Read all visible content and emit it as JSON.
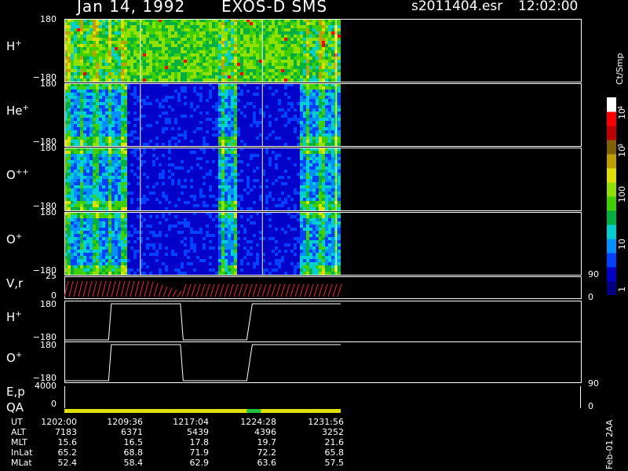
{
  "header": {
    "date": "Jan 14, 1992",
    "instrument": "EXOS-D SMS",
    "file": "s2011404.esr",
    "start_time": "12:02:00"
  },
  "panels": [
    {
      "label_base": "H",
      "label_sup": "+",
      "top_tick": "180",
      "bottom_tick": "−180"
    },
    {
      "label_base": "He",
      "label_sup": "+",
      "top_tick": "180",
      "bottom_tick": "−180"
    },
    {
      "label_base": "O",
      "label_sup": "++",
      "top_tick": "180",
      "bottom_tick": "−180"
    },
    {
      "label_base": "O",
      "label_sup": "+",
      "top_tick": "180",
      "bottom_tick": "−180"
    }
  ],
  "vr_panel": {
    "label": "V,r",
    "top_tick": "25",
    "bottom_tick": "0",
    "right_top": "90",
    "right_bottom": "0"
  },
  "angle_panels": [
    {
      "label_base": "H",
      "label_sup": "+",
      "top_tick": "180",
      "bottom_tick": "−180"
    },
    {
      "label_base": "O",
      "label_sup": "+",
      "top_tick": "180",
      "bottom_tick": "−180"
    }
  ],
  "ep_panel": {
    "label": "E,p",
    "top_tick": "4000",
    "bottom_tick": "0",
    "right_top": "90",
    "right_bottom": "0"
  },
  "qa_panel": {
    "label": "QA"
  },
  "colorbar": {
    "unit": "Ct/Smp",
    "labels": [
      "1",
      "10",
      "100",
      "10",
      "10",
      "3",
      "4"
    ],
    "colors": [
      "#000080",
      "#0000c8",
      "#0040ff",
      "#0090ff",
      "#00d0d0",
      "#00b040",
      "#40d000",
      "#90e000",
      "#e0e000",
      "#c0a000",
      "#806000",
      "#c00000",
      "#ff0000",
      "#ffffff"
    ]
  },
  "ephemeris": {
    "rows": [
      {
        "label": "UT",
        "values": [
          "1202:00",
          "1209:36",
          "1217:04",
          "1224:28",
          "1231:56"
        ]
      },
      {
        "label": "ALT",
        "values": [
          "7183",
          "6371",
          "5439",
          "4396",
          "3252"
        ]
      },
      {
        "label": "MLT",
        "values": [
          "15.6",
          "16.5",
          "17.8",
          "19.7",
          "21.6"
        ]
      },
      {
        "label": "InLat",
        "values": [
          "65.2",
          "68.8",
          "71.9",
          "72.2",
          "65.8"
        ]
      },
      {
        "label": "MLat",
        "values": [
          "52.4",
          "58.4",
          "62.9",
          "63.6",
          "57.5"
        ]
      }
    ]
  },
  "footer": {
    "version": "Feb-01 2AA"
  },
  "chart_data": {
    "type": "heatmap",
    "title": "Jan 14, 1992   EXOS-D SMS",
    "x_ticks_ut": [
      "1202:00",
      "1209:36",
      "1217:04",
      "1224:28",
      "1231:56"
    ],
    "species_panels": [
      "H+",
      "He+",
      "O++",
      "O+"
    ],
    "ylim": [
      -180,
      180
    ],
    "colorbar_range_ct_per_smp": [
      1,
      10000
    ],
    "colorbar_scale": "log",
    "angle_panels": [
      {
        "name": "H+",
        "steps_ut": [
          "1202:00",
          "1207:00",
          "1216:00",
          "1217:00",
          "1225:00",
          "1226:00"
        ],
        "values": [
          -180,
          -180,
          180,
          180,
          -180,
          180
        ]
      },
      {
        "name": "O+",
        "steps_ut": [
          "1202:00",
          "1207:00",
          "1216:00",
          "1217:00",
          "1225:00",
          "1226:00"
        ],
        "values": [
          -180,
          -180,
          180,
          180,
          -180,
          180
        ]
      }
    ],
    "data_end_fraction": 0.535
  }
}
